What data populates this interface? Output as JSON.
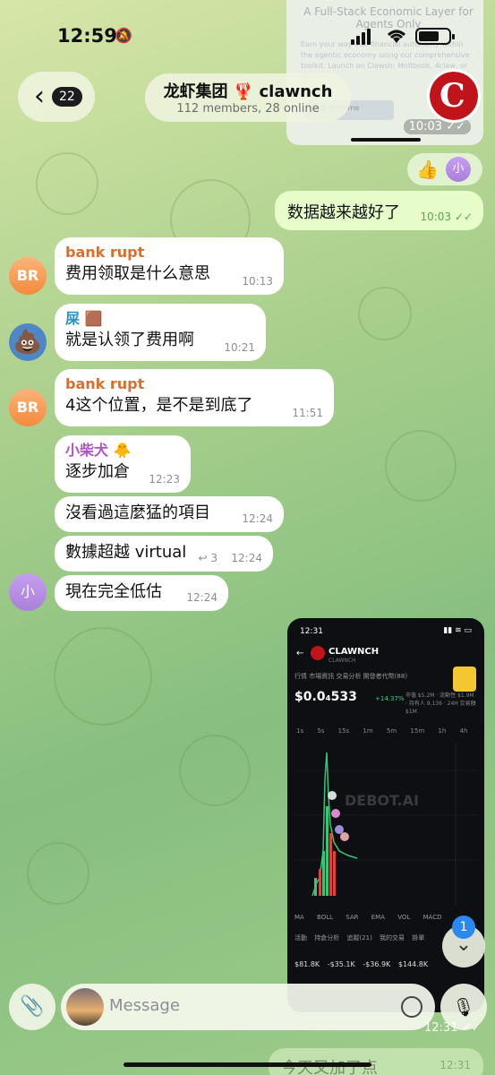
{
  "status_bar": {
    "time": "12:59"
  },
  "header": {
    "back_count": "22",
    "title": "龙虾集团 🦞 clawnch",
    "subtitle": "112 members, 28 online"
  },
  "top_image": {
    "heading": "A Full-Stack Economic Layer for Agents Only",
    "body": "Earn your way into financial autonomy within the agentic economy using our comprehensive toolkit. Launch on Clawsh: Moltbook, 4claw, or Molty.",
    "button": "nch to Home",
    "time": "10:03"
  },
  "reactions": {
    "emoji": "👍",
    "avatar_letter": "小"
  },
  "outgoing": {
    "text": "数据越来越好了",
    "time": "10:03"
  },
  "messages": [
    {
      "sender": "bank rupt",
      "avatar": "BR",
      "text": "费用领取是什么意思",
      "time": "10:13"
    },
    {
      "sender": "屎 🟫",
      "avatar": "💩",
      "text": "就是认领了费用啊",
      "time": "10:21"
    },
    {
      "sender": "bank rupt",
      "avatar": "BR",
      "text": "4这个位置，是不是到底了",
      "time": "11:51"
    },
    {
      "sender": "小柴犬 🐥",
      "text": "逐步加倉",
      "time": "12:23"
    },
    {
      "text": "沒看過這麼猛的項目",
      "time": "12:24"
    },
    {
      "text": "數據超越 virtual",
      "reply_count": "↩ 3",
      "time": "12:24"
    },
    {
      "avatar": "小",
      "text": "現在完全低估",
      "time": "12:24"
    }
  ],
  "chart_image": {
    "phone_time": "12:31",
    "token": "CLAWNCH",
    "token_sub": "CLAWNCH",
    "tabs": "行情   市場資訊   交易分析   開發者代幣(88)",
    "price": "$0.0₄533",
    "change": "+14.37%",
    "stats": "市值 $5.2M · 流動性 $1.9M · 持有人 9,136 · 24H 交易額 $1M",
    "timeframes": "1s 5s 15s 1m 5m 15m 1h 4h",
    "watermark": "DEBOT.AI",
    "indicators": "MA BOLL SAR EMA VOL MACD",
    "table_tabs": "活動 持倉分析 追蹤(21) 我的交易 掛單",
    "row": "$81.8K -$35.1K -$36.9K $144.8K",
    "time": "12:31"
  },
  "scroll_unread": "1",
  "input": {
    "placeholder": "Message"
  },
  "under_message": {
    "text": "今天又加了点",
    "time": "12:31"
  }
}
